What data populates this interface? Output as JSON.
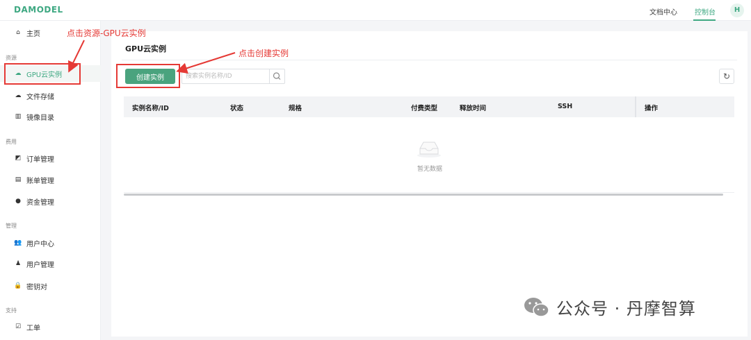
{
  "header": {
    "logo": "DAMODEL",
    "links": [
      {
        "label": "文档中心"
      },
      {
        "label": "控制台",
        "active": true
      }
    ],
    "avatar": "H"
  },
  "sidebar": {
    "home": "主页",
    "groups": [
      {
        "label": "资源",
        "items": [
          {
            "label": "GPU云实例",
            "icon": "cloud-icon",
            "active": true
          },
          {
            "label": "文件存储",
            "icon": "cloud-icon"
          },
          {
            "label": "镜像目录",
            "icon": "book-icon"
          }
        ]
      },
      {
        "label": "费用",
        "items": [
          {
            "label": "订单管理",
            "icon": "order-icon"
          },
          {
            "label": "账单管理",
            "icon": "bill-icon"
          },
          {
            "label": "资金管理",
            "icon": "money-icon"
          }
        ]
      },
      {
        "label": "管理",
        "items": [
          {
            "label": "用户中心",
            "icon": "users-icon"
          },
          {
            "label": "用户管理",
            "icon": "user-manage-icon"
          },
          {
            "label": "密钥对",
            "icon": "lock-icon"
          }
        ]
      },
      {
        "label": "支持",
        "items": [
          {
            "label": "工单",
            "icon": "ticket-icon"
          }
        ]
      }
    ]
  },
  "main": {
    "title": "GPU云实例",
    "create_button": "创建实例",
    "search_placeholder": "搜索实例名称/ID",
    "table": {
      "columns": [
        "实例名称/ID",
        "状态",
        "规格",
        "付费类型",
        "释放时间",
        "SSH",
        "操作"
      ],
      "empty_text": "暂无数据"
    }
  },
  "annotations": {
    "sidebar_hint": "点击资源-GPU云实例",
    "create_hint": "点击创建实例",
    "color": "#e53935"
  },
  "watermark": "公众号 · 丹摩智算",
  "colors": {
    "accent": "#3ea882",
    "button": "#4aa37e",
    "annotation": "#e53935"
  }
}
